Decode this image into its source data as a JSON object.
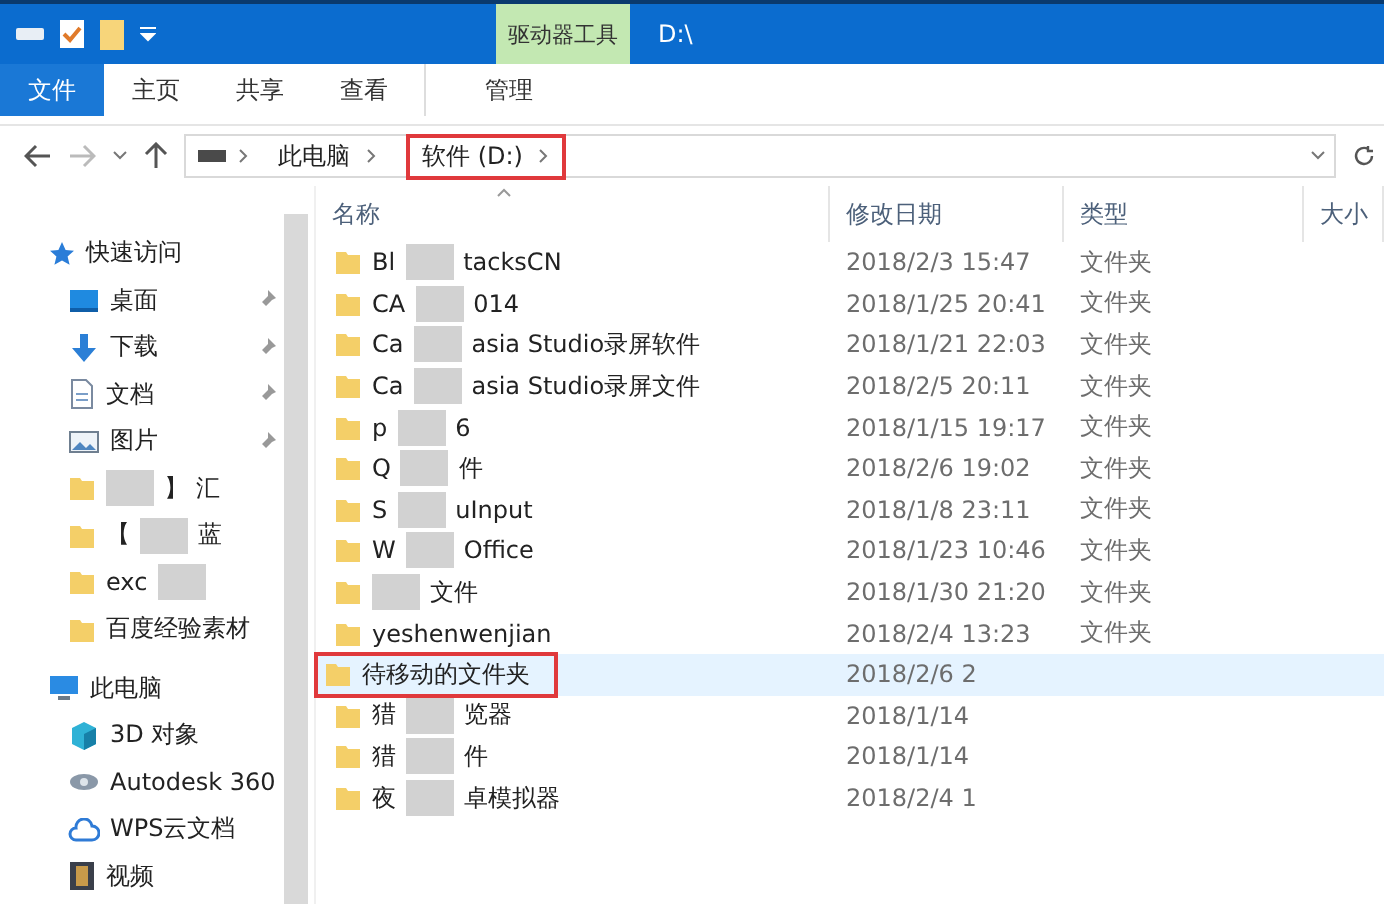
{
  "window": {
    "title": "D:\\",
    "context_tab": "驱动器工具"
  },
  "ribbon_tabs": [
    {
      "label": "文件",
      "kind": "file"
    },
    {
      "label": "主页",
      "kind": "plain"
    },
    {
      "label": "共享",
      "kind": "plain"
    },
    {
      "label": "查看",
      "kind": "plain"
    },
    {
      "label": "管理",
      "kind": "context"
    }
  ],
  "address": {
    "crumbs": [
      {
        "label": "此电脑",
        "highlighted": false
      },
      {
        "label": "软件 (D:)",
        "highlighted": true
      }
    ]
  },
  "sidebar": {
    "sections": [
      {
        "label": "快速访问",
        "items": [
          {
            "pinned": true,
            "parts": [
              {
                "kind": "text",
                "text": "桌面"
              }
            ]
          },
          {
            "pinned": true,
            "parts": [
              {
                "kind": "text",
                "text": "下载"
              }
            ]
          },
          {
            "pinned": true,
            "parts": [
              {
                "kind": "text",
                "text": "文档"
              }
            ]
          },
          {
            "pinned": true,
            "parts": [
              {
                "kind": "text",
                "text": "图片"
              }
            ]
          },
          {
            "pinned": false,
            "parts": [
              {
                "kind": "blur"
              },
              {
                "kind": "text",
                "text": "】 汇"
              }
            ]
          },
          {
            "pinned": false,
            "parts": [
              {
                "kind": "text",
                "text": "【"
              },
              {
                "kind": "blur"
              },
              {
                "kind": "text",
                "text": "蓝"
              }
            ]
          },
          {
            "pinned": false,
            "parts": [
              {
                "kind": "text",
                "text": "exc"
              },
              {
                "kind": "blur"
              }
            ]
          },
          {
            "pinned": false,
            "parts": [
              {
                "kind": "text",
                "text": "百度经验素材"
              }
            ]
          }
        ]
      },
      {
        "label": "此电脑",
        "items": [
          {
            "pinned": false,
            "parts": [
              {
                "kind": "text",
                "text": "3D 对象"
              }
            ]
          },
          {
            "pinned": false,
            "parts": [
              {
                "kind": "text",
                "text": "Autodesk 360"
              }
            ]
          },
          {
            "pinned": false,
            "parts": [
              {
                "kind": "text",
                "text": "WPS云文档"
              }
            ]
          },
          {
            "pinned": false,
            "parts": [
              {
                "kind": "text",
                "text": "视频"
              }
            ]
          }
        ]
      }
    ]
  },
  "table": {
    "columns": [
      "名称",
      "修改日期",
      "类型",
      "大小"
    ],
    "rows": [
      {
        "parts": [
          {
            "kind": "text",
            "text": "Bl"
          },
          {
            "kind": "blur"
          },
          {
            "kind": "text",
            "text": "tacksCN"
          }
        ],
        "date": "2018/2/3 15:47",
        "type": "文件夹",
        "selected": false,
        "highlighted": false
      },
      {
        "parts": [
          {
            "kind": "text",
            "text": "CA"
          },
          {
            "kind": "blur"
          },
          {
            "kind": "text",
            "text": "014"
          }
        ],
        "date": "2018/1/25 20:41",
        "type": "文件夹",
        "selected": false,
        "highlighted": false
      },
      {
        "parts": [
          {
            "kind": "text",
            "text": "Ca"
          },
          {
            "kind": "blur"
          },
          {
            "kind": "text",
            "text": "asia Studio录屏软件"
          }
        ],
        "date": "2018/1/21 22:03",
        "type": "文件夹",
        "selected": false,
        "highlighted": false
      },
      {
        "parts": [
          {
            "kind": "text",
            "text": "Ca"
          },
          {
            "kind": "blur"
          },
          {
            "kind": "text",
            "text": "asia Studio录屏文件"
          }
        ],
        "date": "2018/2/5 20:11",
        "type": "文件夹",
        "selected": false,
        "highlighted": false
      },
      {
        "parts": [
          {
            "kind": "text",
            "text": "p"
          },
          {
            "kind": "blur"
          },
          {
            "kind": "text",
            "text": "6"
          }
        ],
        "date": "2018/1/15 19:17",
        "type": "文件夹",
        "selected": false,
        "highlighted": false
      },
      {
        "parts": [
          {
            "kind": "text",
            "text": "Q"
          },
          {
            "kind": "blur"
          },
          {
            "kind": "text",
            "text": "件"
          }
        ],
        "date": "2018/2/6 19:02",
        "type": "文件夹",
        "selected": false,
        "highlighted": false
      },
      {
        "parts": [
          {
            "kind": "text",
            "text": "S"
          },
          {
            "kind": "blur"
          },
          {
            "kind": "text",
            "text": "uInput"
          }
        ],
        "date": "2018/1/8 23:11",
        "type": "文件夹",
        "selected": false,
        "highlighted": false
      },
      {
        "parts": [
          {
            "kind": "text",
            "text": "W"
          },
          {
            "kind": "blur"
          },
          {
            "kind": "text",
            "text": "Office"
          }
        ],
        "date": "2018/1/23 10:46",
        "type": "文件夹",
        "selected": false,
        "highlighted": false
      },
      {
        "parts": [
          {
            "kind": "blur"
          },
          {
            "kind": "text",
            "text": "文件"
          }
        ],
        "date": "2018/1/30 21:20",
        "type": "文件夹",
        "selected": false,
        "highlighted": false
      },
      {
        "parts": [
          {
            "kind": "text",
            "text": "yeshenwenjian"
          }
        ],
        "date": "2018/2/4 13:23",
        "type": "文件夹",
        "selected": false,
        "highlighted": false
      },
      {
        "parts": [
          {
            "kind": "text",
            "text": "待移动的文件夹"
          }
        ],
        "date": "2018/2/6 2",
        "selected": true,
        "highlighted": true
      },
      {
        "parts": [
          {
            "kind": "text",
            "text": "猎"
          },
          {
            "kind": "blur"
          },
          {
            "kind": "text",
            "text": "览器"
          }
        ],
        "date": "2018/1/14",
        "selected": false,
        "highlighted": false
      },
      {
        "parts": [
          {
            "kind": "text",
            "text": "猎"
          },
          {
            "kind": "blur"
          },
          {
            "kind": "text",
            "text": "件"
          }
        ],
        "date": "2018/1/14",
        "selected": false,
        "highlighted": false
      },
      {
        "parts": [
          {
            "kind": "text",
            "text": "夜"
          },
          {
            "kind": "blur"
          },
          {
            "kind": "text",
            "text": "卓模拟器"
          }
        ],
        "date": "2018/2/4 1",
        "selected": false,
        "highlighted": false
      }
    ]
  }
}
